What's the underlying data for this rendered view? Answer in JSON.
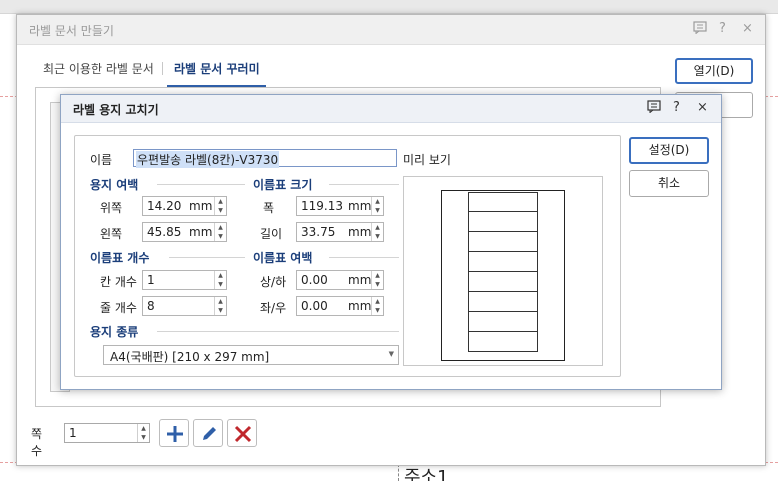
{
  "background": {
    "bottom_text": "주소1"
  },
  "dialog": {
    "title": "라벨 문서 만들기",
    "controls": {
      "help": "?",
      "close": "×"
    },
    "tabs": [
      {
        "label": "최근 이용한 라벨 문서",
        "active": false
      },
      {
        "label": "라벨 문서 꾸러미",
        "active": true
      }
    ],
    "side_buttons": [
      {
        "label": "열기(D)",
        "primary": true
      }
    ],
    "bottom": {
      "copies_label": "쪽 수",
      "copies_value": "1"
    }
  },
  "label_editor": {
    "title": "라벨 용지 고치기",
    "controls": {
      "help": "?",
      "close": "×"
    },
    "name": {
      "label": "이름",
      "value": "우편발송 라벨(8칸)-V3730"
    },
    "margins": {
      "header": "용지 여백",
      "top": {
        "label": "위쪽",
        "value": "14.20",
        "unit": "mm"
      },
      "left": {
        "label": "왼쪽",
        "value": "45.85",
        "unit": "mm"
      }
    },
    "label_size": {
      "header": "이름표 크기",
      "width": {
        "label": "폭",
        "value": "119.13",
        "unit": "mm"
      },
      "height": {
        "label": "길이",
        "value": "33.75",
        "unit": "mm"
      }
    },
    "label_count": {
      "header": "이름표 개수",
      "columns": {
        "label": "칸 개수",
        "value": "1"
      },
      "rows": {
        "label": "줄 개수",
        "value": "8"
      }
    },
    "label_gap": {
      "header": "이름표 여백",
      "vertical": {
        "label": "상/하",
        "value": "0.00",
        "unit": "mm"
      },
      "horizontal": {
        "label": "좌/우",
        "value": "0.00",
        "unit": "mm"
      }
    },
    "paper_type": {
      "header": "용지 종류",
      "value": "A4(국배판) [210 x 297 mm]"
    },
    "preview": {
      "label": "미리 보기",
      "rows": 8,
      "columns": 1
    },
    "buttons": {
      "ok": "설정(D)",
      "cancel": "취소"
    }
  },
  "colors": {
    "accent": "#3a6fbf",
    "header_text": "#1b3e7a",
    "delete_red": "#c0282d"
  }
}
